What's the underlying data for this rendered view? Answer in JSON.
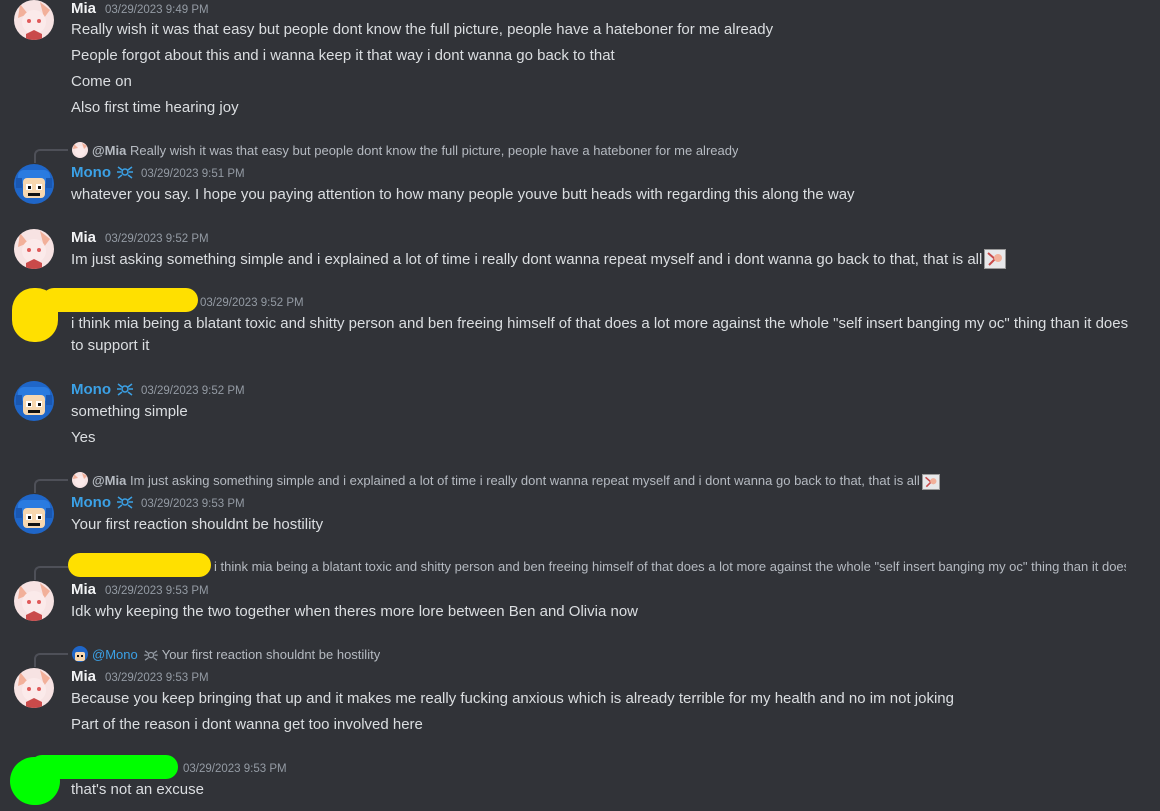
{
  "colors": {
    "background": "#313338",
    "text": "#dbdee1",
    "username_default": "#f2f3f5",
    "username_mono": "#3ba1e6",
    "timestamp": "#949ba4",
    "redaction_yellow": "#ffe000",
    "redaction_green": "#00ff00"
  },
  "messages": [
    {
      "author": "Mia",
      "timestamp": "03/29/2023 9:49 PM",
      "lines": [
        "Really wish it was that easy but people dont know the full picture, people have a hateboner for me already",
        "People forgot about this and i wanna keep it that way i dont wanna go back to that",
        "Come on",
        "Also first time hearing joy"
      ]
    },
    {
      "reply_to": "@Mia",
      "reply_text": "Really wish it was that easy but people dont know the full picture, people have a hateboner for me already",
      "author": "Mono",
      "timestamp": "03/29/2023 9:51 PM",
      "lines": [
        "whatever you say. I hope you paying attention to how many people youve butt heads with regarding this along the way"
      ]
    },
    {
      "author": "Mia",
      "timestamp": "03/29/2023 9:52 PM",
      "lines": [
        "Im just asking something simple and i explained a lot of time i really dont wanna repeat myself and i dont wanna go back to that, that is all"
      ]
    },
    {
      "author": "",
      "timestamp": "03/29/2023 9:52 PM",
      "lines": [
        "i think mia being a blatant toxic and shitty person and ben freeing himself of that does a lot more against the whole \"self insert banging my oc\" thing than it does to support it"
      ]
    },
    {
      "author": "Mono",
      "timestamp": "03/29/2023 9:52 PM",
      "lines": [
        "something simple",
        "Yes"
      ]
    },
    {
      "reply_to": "@Mia",
      "reply_text": "Im just asking something simple and i explained a lot of time i really dont wanna repeat myself and i dont wanna go back to that, that is all",
      "author": "Mono",
      "timestamp": "03/29/2023 9:53 PM",
      "lines": [
        "Your first reaction shouldnt be hostility"
      ]
    },
    {
      "reply_to": "",
      "reply_text": "i think mia being a blatant toxic and shitty person and ben freeing himself of that does a lot more against the whole \"self insert banging my oc\" thing than it does to support it",
      "author": "Mia",
      "timestamp": "03/29/2023 9:53 PM",
      "lines": [
        "Idk why keeping the two together when theres more lore between Ben and Olivia now"
      ]
    },
    {
      "reply_to": "@Mono",
      "reply_text": "Your first reaction shouldnt be hostility",
      "author": "Mia",
      "timestamp": "03/29/2023 9:53 PM",
      "lines": [
        "Because you keep bringing that up and it makes me really fucking anxious which is already terrible for my health and no im not joking",
        "Part of the reason i dont wanna get too involved here"
      ]
    },
    {
      "author": "",
      "timestamp": "03/29/2023 9:53 PM",
      "lines": [
        "that's not an excuse"
      ]
    }
  ]
}
